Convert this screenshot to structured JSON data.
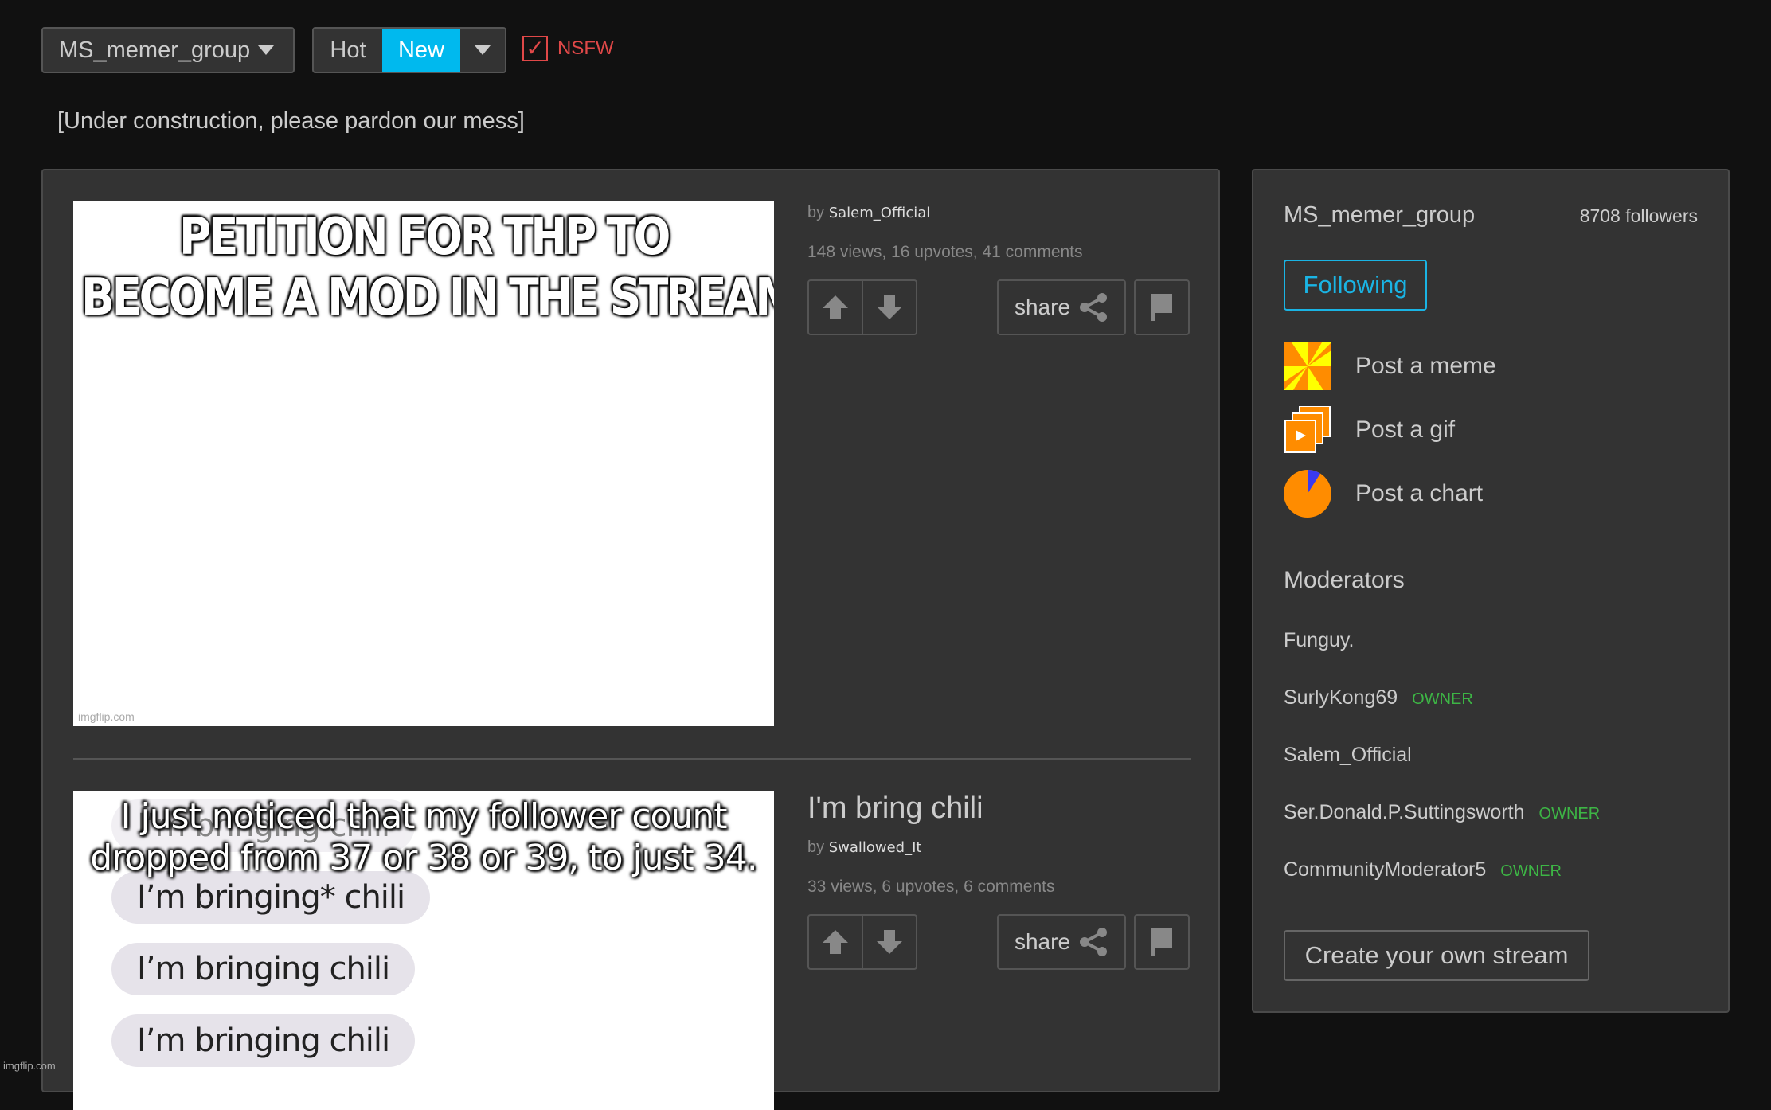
{
  "toolbar": {
    "stream_name": "MS_memer_group",
    "sort_options": [
      "Hot",
      "New"
    ],
    "sort_selected": "New",
    "nsfw_label": "NSFW",
    "nsfw_checked": true,
    "nsfw_check_glyph": "✓"
  },
  "notice": "[Under construction, please pardon our mess]",
  "colors": {
    "accent": "#00b9ee",
    "nsfw": "#e04848",
    "owner": "#3db545",
    "panel": "#333333",
    "background": "#111111"
  },
  "posts": [
    {
      "title": "",
      "by_label": "by",
      "author": "Salem_Official",
      "stats": "148 views, 16 upvotes, 41 comments",
      "image_caption_lines": [
        "PETITION FOR THP TO",
        "BECOME A MOD IN THE STREAM"
      ],
      "watermark": "imgflip.com",
      "share_label": "share"
    },
    {
      "title": "I'm bring chili",
      "by_label": "by",
      "author": "Swallowed_It",
      "stats": "33 views, 6 upvotes, 6 comments",
      "image_caption_lines": [
        "I just noticed that my follower count",
        "dropped from 37 or 38 or 39, to just 34."
      ],
      "image_bubbles": [
        "I’m bringing chili",
        "I’m bringing* chili",
        "I’m bringing chili",
        "I’m bringing chili"
      ],
      "share_label": "share"
    }
  ],
  "sidebar": {
    "stream_name": "MS_memer_group",
    "followers": "8708 followers",
    "follow_button": "Following",
    "actions": [
      {
        "label": "Post a meme",
        "icon": "meme-pinwheel-icon"
      },
      {
        "label": "Post a gif",
        "icon": "gif-stack-icon"
      },
      {
        "label": "Post a chart",
        "icon": "pie-chart-icon"
      }
    ],
    "moderators_header": "Moderators",
    "moderators": [
      {
        "name": "Funguy.",
        "badge": ""
      },
      {
        "name": "SurlyKong69",
        "badge": "OWNER"
      },
      {
        "name": "Salem_Official",
        "badge": ""
      },
      {
        "name": "Ser.Donald.P.Suttingsworth",
        "badge": "OWNER"
      },
      {
        "name": "CommunityModerator5",
        "badge": "OWNER"
      }
    ],
    "create_button": "Create your own stream"
  },
  "page_watermark": "imgflip.com"
}
